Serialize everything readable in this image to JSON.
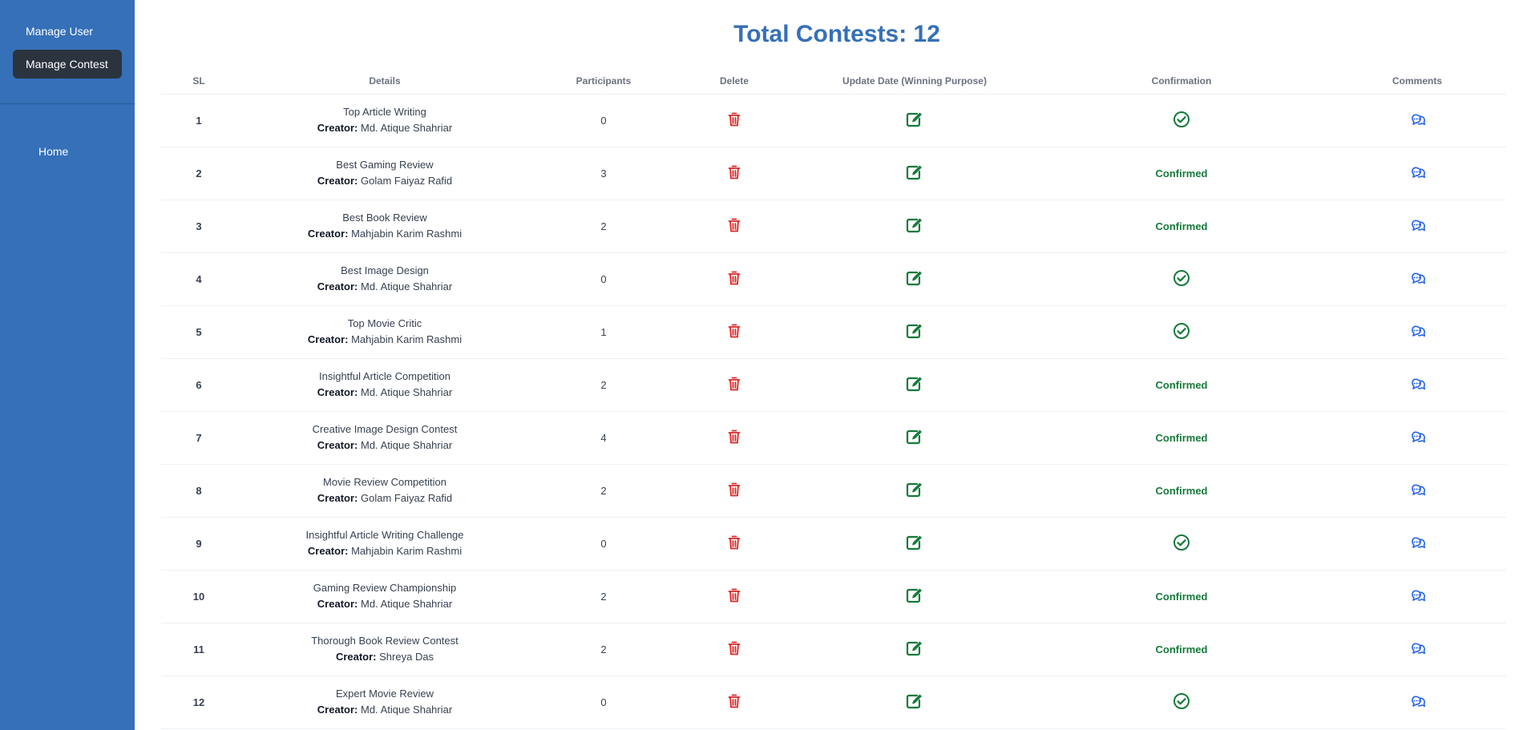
{
  "sidebar": {
    "items": [
      {
        "label": "Manage User",
        "active": false
      },
      {
        "label": "Manage Contest",
        "active": true
      }
    ],
    "home_label": "Home",
    "background": "#3570b8",
    "active_background": "#2b333f"
  },
  "header": {
    "title": "Total Contests: 12",
    "title_color": "#3570b8"
  },
  "table": {
    "columns": [
      "SL",
      "Details",
      "Participants",
      "Delete",
      "Update Date (Winning Purpose)",
      "Confirmation",
      "Comments"
    ],
    "creator_label": "Creator:",
    "confirmed_label": "Confirmed",
    "icons": {
      "delete": "trash-icon",
      "update": "edit-icon",
      "unconfirmed": "check-circle-icon",
      "comments": "chat-bubbles-icon"
    },
    "colors": {
      "delete": "#dc2626",
      "update": "#157a3a",
      "confirm": "#157a3a",
      "comments": "#2563eb"
    },
    "rows": [
      {
        "sl": "1",
        "name": "Top Article Writing",
        "creator": "Md. Atique Shahriar",
        "participants": "0",
        "confirmed": false
      },
      {
        "sl": "2",
        "name": "Best Gaming Review",
        "creator": "Golam Faiyaz Rafid",
        "participants": "3",
        "confirmed": true
      },
      {
        "sl": "3",
        "name": "Best Book Review",
        "creator": "Mahjabin Karim Rashmi",
        "participants": "2",
        "confirmed": true
      },
      {
        "sl": "4",
        "name": "Best Image Design",
        "creator": "Md. Atique Shahriar",
        "participants": "0",
        "confirmed": false
      },
      {
        "sl": "5",
        "name": "Top Movie Critic",
        "creator": "Mahjabin Karim Rashmi",
        "participants": "1",
        "confirmed": false
      },
      {
        "sl": "6",
        "name": "Insightful Article Competition",
        "creator": "Md. Atique Shahriar",
        "participants": "2",
        "confirmed": true
      },
      {
        "sl": "7",
        "name": "Creative Image Design Contest",
        "creator": "Md. Atique Shahriar",
        "participants": "4",
        "confirmed": true
      },
      {
        "sl": "8",
        "name": "Movie Review Competition",
        "creator": "Golam Faiyaz Rafid",
        "participants": "2",
        "confirmed": true
      },
      {
        "sl": "9",
        "name": "Insightful Article Writing Challenge",
        "creator": "Mahjabin Karim Rashmi",
        "participants": "0",
        "confirmed": false
      },
      {
        "sl": "10",
        "name": "Gaming Review Championship",
        "creator": "Md. Atique Shahriar",
        "participants": "2",
        "confirmed": true
      },
      {
        "sl": "11",
        "name": "Thorough Book Review Contest",
        "creator": "Shreya Das",
        "participants": "2",
        "confirmed": true
      },
      {
        "sl": "12",
        "name": "Expert Movie Review",
        "creator": "Md. Atique Shahriar",
        "participants": "0",
        "confirmed": false
      }
    ]
  }
}
